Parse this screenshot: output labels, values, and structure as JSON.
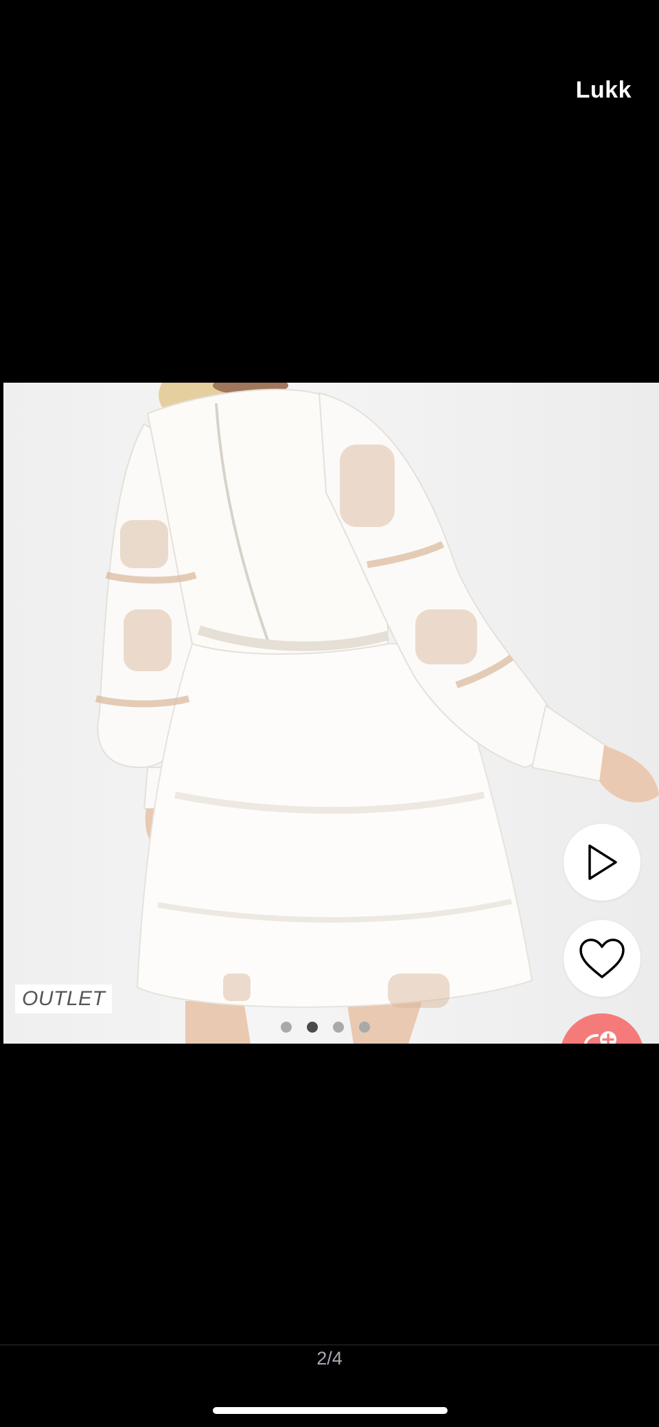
{
  "header": {
    "close_label": "Lukk"
  },
  "gallery": {
    "badge_label": "OUTLET",
    "current_index": 2,
    "total": 4,
    "counter_text": "2/4",
    "dots": [
      {
        "active": false
      },
      {
        "active": true
      },
      {
        "active": false
      },
      {
        "active": false
      }
    ]
  },
  "actions": {
    "play_icon": "play-icon",
    "favorite_icon": "heart-icon",
    "cart_icon": "cart-add-icon",
    "cart_color": "#f57b7b"
  }
}
